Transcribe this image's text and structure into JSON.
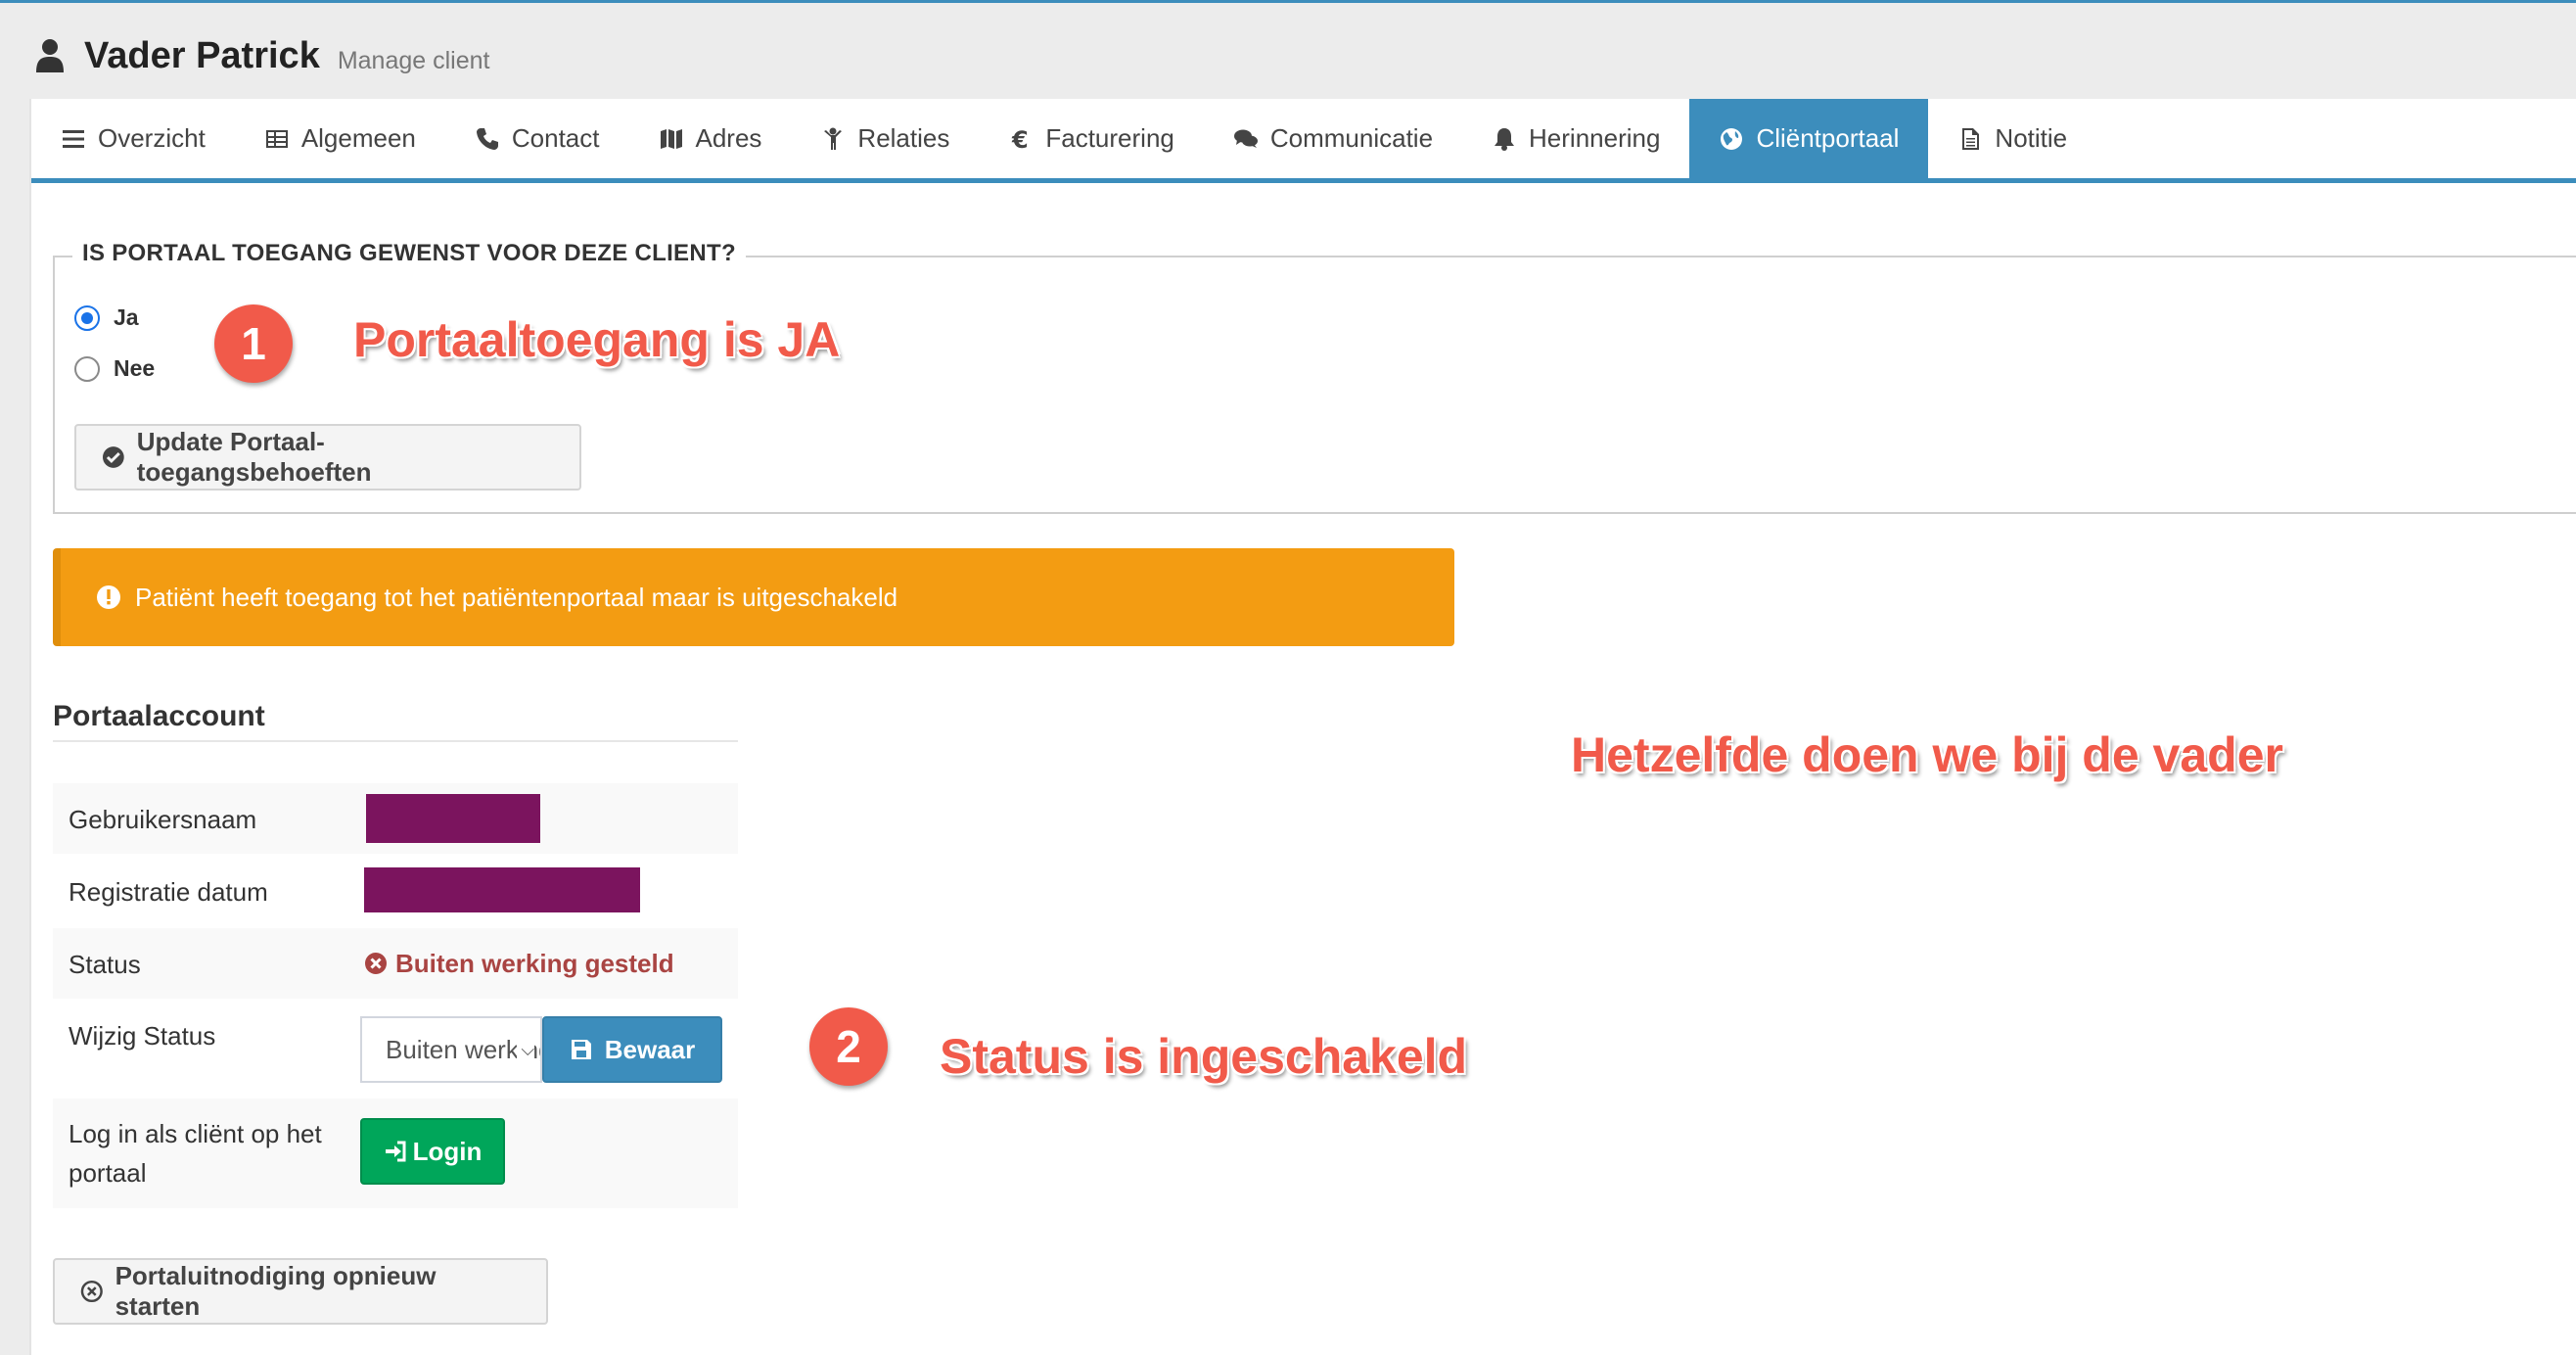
{
  "header": {
    "title": "Vader Patrick",
    "subtitle": "Manage client"
  },
  "tabs": [
    {
      "label": "Overzicht",
      "icon": "list-icon"
    },
    {
      "label": "Algemeen",
      "icon": "table-icon"
    },
    {
      "label": "Contact",
      "icon": "phone-icon"
    },
    {
      "label": "Adres",
      "icon": "map-icon"
    },
    {
      "label": "Relaties",
      "icon": "child-icon"
    },
    {
      "label": "Facturering",
      "icon": "euro-icon"
    },
    {
      "label": "Communicatie",
      "icon": "comments-icon"
    },
    {
      "label": "Herinnering",
      "icon": "bell-icon"
    },
    {
      "label": "Cliëntportaal",
      "icon": "globe-icon",
      "active": true
    },
    {
      "label": "Notitie",
      "icon": "file-icon"
    }
  ],
  "portal_access": {
    "legend": "IS PORTAAL TOEGANG GEWENST VOOR DEZE CLIENT?",
    "options": [
      {
        "label": "Ja",
        "checked": true
      },
      {
        "label": "Nee",
        "checked": false
      }
    ],
    "update_button": "Update Portaal-toegangsbehoeften"
  },
  "alert": {
    "text": "Patiënt heeft toegang tot het patiëntenportaal maar is uitgeschakeld",
    "color": "#f39c12"
  },
  "account": {
    "title": "Portaalaccount",
    "username_label": "Gebruikersnaam",
    "registration_label": "Registratie datum",
    "status_label": "Status",
    "status_value": "Buiten werking gesteld",
    "change_status_label": "Wijzig Status",
    "status_select_value": "Buiten werking gesteld",
    "save_button": "Bewaar",
    "login_label": "Log in als cliënt op het portaal",
    "login_button": "Login"
  },
  "restart_invite_button": "Portaluitnodiging opnieuw starten",
  "annotations": {
    "badge1": "1",
    "text1": "Portaaltoegang is JA",
    "text_middle": "Hetzelfde doen we bij de vader",
    "badge2": "2",
    "text2": "Status is ingeschakeld"
  },
  "colors": {
    "primary": "#3c8dbc",
    "warning": "#f39c12",
    "success": "#00a65a",
    "danger": "#a94442",
    "annotation": "#f15a4a",
    "redaction": "#7b145e"
  }
}
